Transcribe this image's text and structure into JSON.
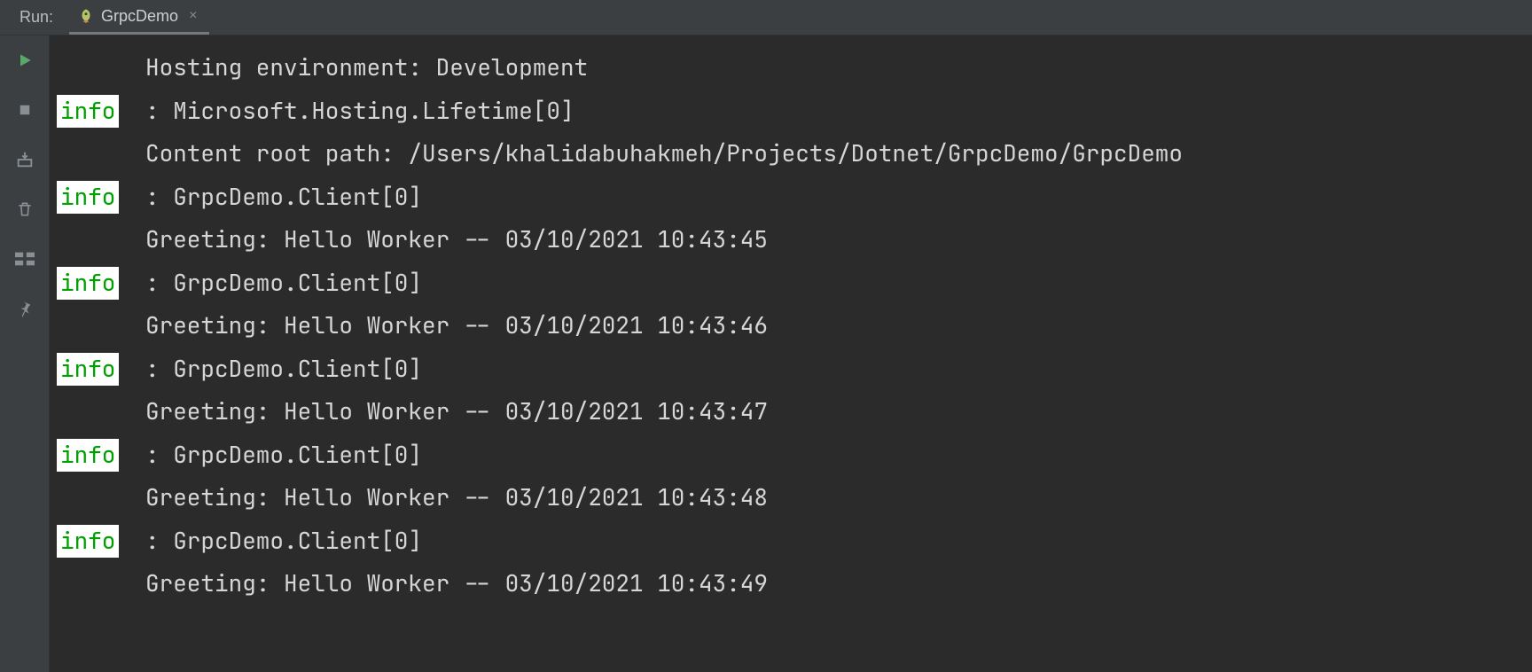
{
  "header": {
    "run_label": "Run:",
    "tab_label": "GrpcDemo"
  },
  "console": {
    "lines": [
      {
        "badge": null,
        "indent": true,
        "text": "Hosting environment: Development"
      },
      {
        "badge": "info",
        "indent": false,
        "text": "Microsoft.Hosting.Lifetime[0]"
      },
      {
        "badge": null,
        "indent": true,
        "text": "Content root path: /Users/khalidabuhakmeh/Projects/Dotnet/GrpcDemo/GrpcDemo"
      },
      {
        "badge": "info",
        "indent": false,
        "text": "GrpcDemo.Client[0]"
      },
      {
        "badge": null,
        "indent": true,
        "text": "Greeting: Hello Worker -- 03/10/2021 10:43:45"
      },
      {
        "badge": "info",
        "indent": false,
        "text": "GrpcDemo.Client[0]"
      },
      {
        "badge": null,
        "indent": true,
        "text": "Greeting: Hello Worker -- 03/10/2021 10:43:46"
      },
      {
        "badge": "info",
        "indent": false,
        "text": "GrpcDemo.Client[0]"
      },
      {
        "badge": null,
        "indent": true,
        "text": "Greeting: Hello Worker -- 03/10/2021 10:43:47"
      },
      {
        "badge": "info",
        "indent": false,
        "text": "GrpcDemo.Client[0]"
      },
      {
        "badge": null,
        "indent": true,
        "text": "Greeting: Hello Worker -- 03/10/2021 10:43:48"
      },
      {
        "badge": "info",
        "indent": false,
        "text": "GrpcDemo.Client[0]"
      },
      {
        "badge": null,
        "indent": true,
        "text": "Greeting: Hello Worker -- 03/10/2021 10:43:49"
      }
    ]
  }
}
